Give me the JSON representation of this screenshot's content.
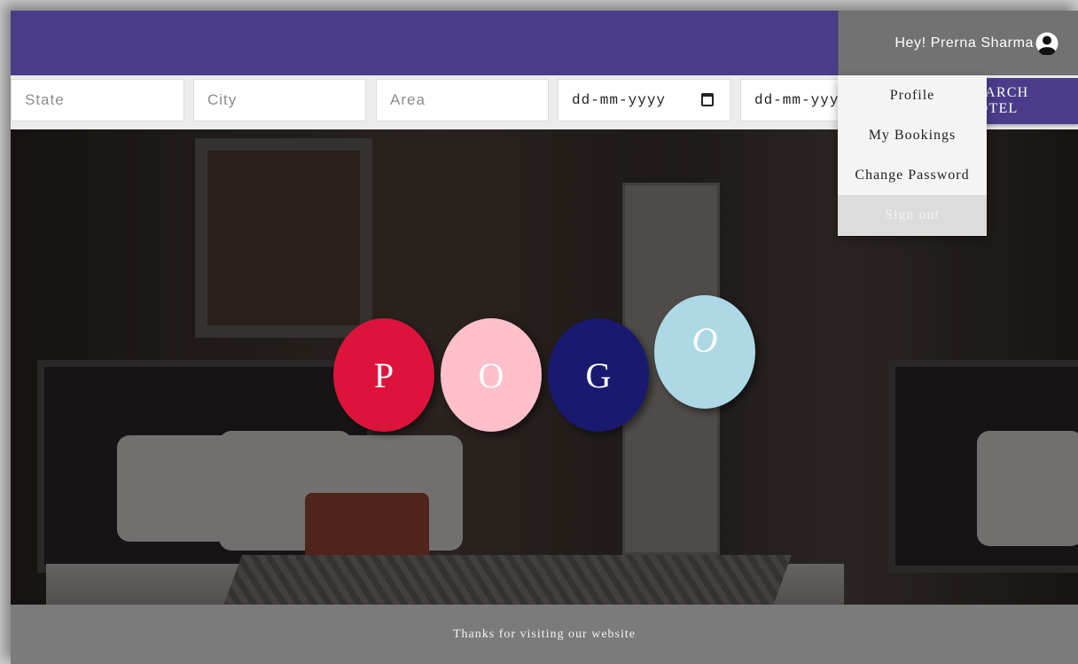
{
  "header": {
    "greeting": "Hey! Prerna Sharma",
    "user_icon": "user-avatar-icon",
    "bar_color": "#4b3c8a"
  },
  "search": {
    "state_placeholder": "State",
    "city_placeholder": "City",
    "area_placeholder": "Area",
    "checkin_value": "dd-mm-yyyy",
    "checkout_value": "dd-mm-yyyy",
    "calendar_icon": "calendar-icon",
    "button_label": "SEARCH HOTEL"
  },
  "logo": {
    "letters": [
      {
        "char": "P",
        "color": "#dc143c"
      },
      {
        "char": "O",
        "color": "#ffc0cb"
      },
      {
        "char": "G",
        "color": "#191970"
      },
      {
        "char": "O",
        "color": "#add8e6"
      }
    ]
  },
  "user_menu": {
    "items": [
      "Profile",
      "My Bookings",
      "Change Password",
      "Sign out"
    ]
  },
  "footer": {
    "text": "Thanks for visiting our website"
  }
}
